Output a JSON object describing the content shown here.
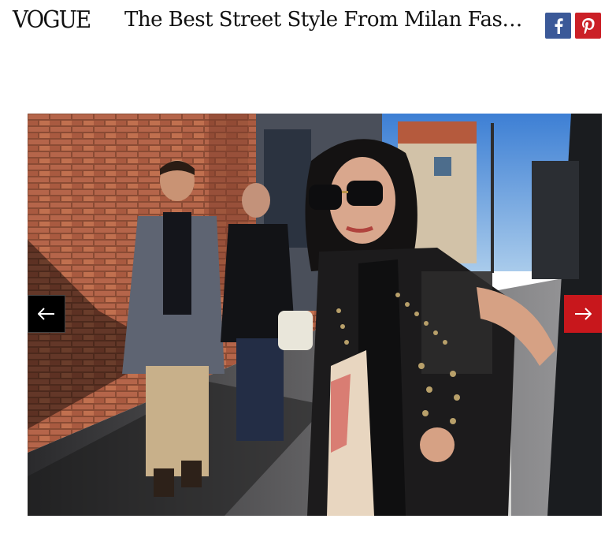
{
  "header": {
    "logo": "VOGUE",
    "article_title": "The Best Street Style From Milan Fashion Week",
    "share": {
      "facebook_icon": "facebook-icon",
      "pinterest_icon": "pinterest-icon",
      "facebook_color": "#3b5998",
      "pinterest_color": "#cb2027"
    }
  },
  "gallery": {
    "photo_icon": "street-style-photo",
    "prev_icon": "arrow-left-icon",
    "next_icon": "arrow-right-icon",
    "next_color": "#c8171c"
  }
}
